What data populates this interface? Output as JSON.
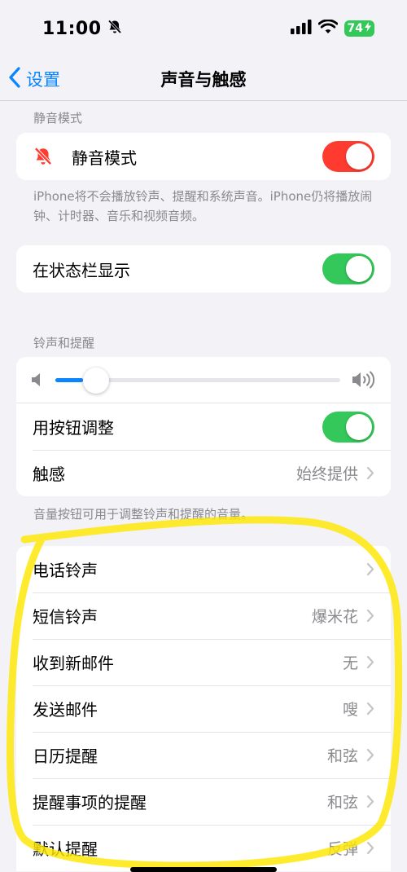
{
  "status_bar": {
    "time": "11:00",
    "battery": "74"
  },
  "nav": {
    "back_label": "设置",
    "title": "声音与触感"
  },
  "silent_section": {
    "header": "静音模式",
    "row_label": "静音模式",
    "toggle_on": true,
    "toggle_color": "#ff3b30",
    "note": "iPhone将不会播放铃声、提醒和系统声音。iPhone仍将播放闹钟、计时器、音乐和视频音频。"
  },
  "status_bar_display": {
    "label": "在状态栏显示",
    "toggle_on": true
  },
  "ringer_section": {
    "header": "铃声和提醒",
    "volume_level": 0.05,
    "adjust_with_buttons": {
      "label": "用按钮调整",
      "toggle_on": true
    },
    "haptics": {
      "label": "触感",
      "value": "始终提供"
    },
    "note": "音量按钮可用于调整铃声和提醒的音量。"
  },
  "sounds_list": [
    {
      "label": "电话铃声",
      "value": ""
    },
    {
      "label": "短信铃声",
      "value": "爆米花"
    },
    {
      "label": "收到新邮件",
      "value": "无"
    },
    {
      "label": "发送邮件",
      "value": "嗖"
    },
    {
      "label": "日历提醒",
      "value": "和弦"
    },
    {
      "label": "提醒事项的提醒",
      "value": "和弦"
    },
    {
      "label": "默认提醒",
      "value": "反弹"
    }
  ],
  "colors": {
    "accent": "#0a84ff",
    "toggle_green": "#34c759",
    "toggle_red": "#ff3b30",
    "highlight": "#ffe600"
  }
}
